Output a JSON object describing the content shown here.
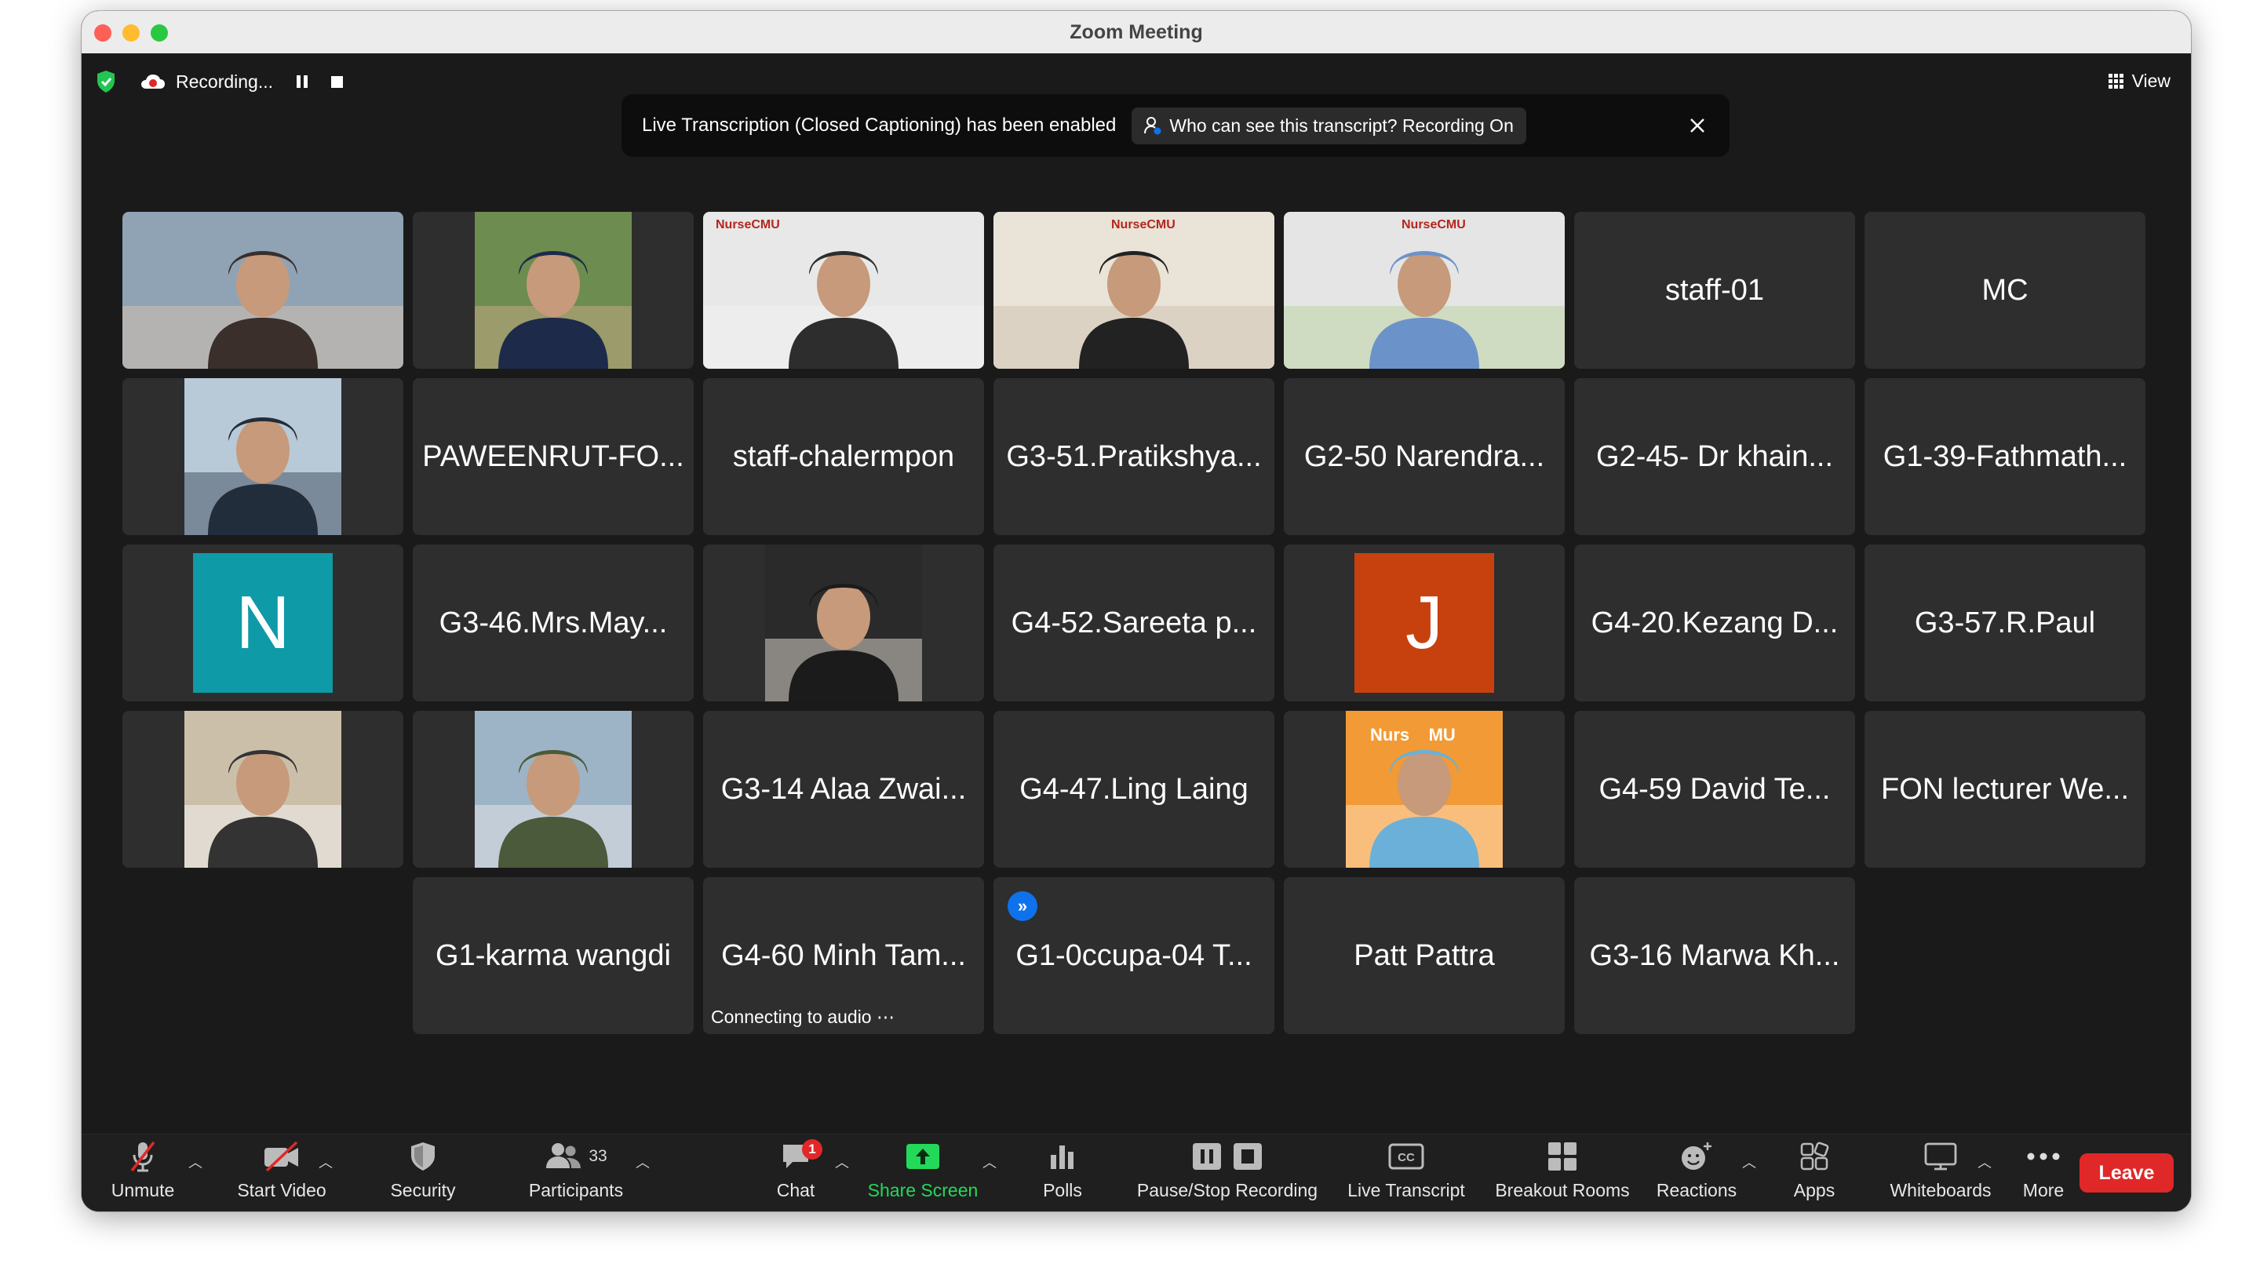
{
  "window": {
    "title": "Zoom Meeting"
  },
  "topbar": {
    "recording_label": "Recording...",
    "view_label": "View"
  },
  "banner": {
    "message": "Live Transcription (Closed Captioning) has been enabled",
    "who_label": "Who can see this transcript? Recording On"
  },
  "participants": [
    {
      "name": "",
      "kind": "video"
    },
    {
      "name": "",
      "kind": "video"
    },
    {
      "name": "",
      "kind": "video"
    },
    {
      "name": "",
      "kind": "video",
      "active": true
    },
    {
      "name": "",
      "kind": "video"
    },
    {
      "name": "staff-01",
      "kind": "name"
    },
    {
      "name": "MC",
      "kind": "name"
    },
    {
      "name": "",
      "kind": "video"
    },
    {
      "name": "PAWEENRUT-FO...",
      "kind": "name"
    },
    {
      "name": "staff-chalermpon",
      "kind": "name"
    },
    {
      "name": "G3-51.Pratikshya...",
      "kind": "name"
    },
    {
      "name": "G2-50 Narendra...",
      "kind": "name"
    },
    {
      "name": "G2-45- Dr khain...",
      "kind": "name"
    },
    {
      "name": "G1-39-Fathmath...",
      "kind": "name"
    },
    {
      "name": "",
      "kind": "avatar",
      "initial": "N",
      "color": "#0e9aa7"
    },
    {
      "name": "G3-46.Mrs.May...",
      "kind": "name"
    },
    {
      "name": "",
      "kind": "video"
    },
    {
      "name": "G4-52.Sareeta p...",
      "kind": "name"
    },
    {
      "name": "",
      "kind": "avatar",
      "initial": "J",
      "color": "#c7410f"
    },
    {
      "name": "G4-20.Kezang D...",
      "kind": "name"
    },
    {
      "name": "G3-57.R.Paul",
      "kind": "name"
    },
    {
      "name": "",
      "kind": "video"
    },
    {
      "name": "",
      "kind": "video"
    },
    {
      "name": "G3-14 Alaa Zwai...",
      "kind": "name"
    },
    {
      "name": "G4-47.Ling Laing",
      "kind": "name"
    },
    {
      "name": "",
      "kind": "video"
    },
    {
      "name": "G4-59 David  Te...",
      "kind": "name"
    },
    {
      "name": "FON lecturer We...",
      "kind": "name"
    },
    {
      "name": "G1-karma wangdi",
      "kind": "name"
    },
    {
      "name": "G4-60 Minh Tam...",
      "kind": "name",
      "status": "Connecting to audio  ⋯"
    },
    {
      "name": "G1-0ccupa-04 T...",
      "kind": "name",
      "badge": true
    },
    {
      "name": "Patt Pattra",
      "kind": "name"
    },
    {
      "name": "G3-16 Marwa Kh...",
      "kind": "name"
    }
  ],
  "video_logos": {
    "nursecmu": "NurseCMU",
    "nursecmu_partial": "Nurs    MU"
  },
  "toolbar": {
    "unmute": "Unmute",
    "start_video": "Start Video",
    "security": "Security",
    "participants": "Participants",
    "participants_count": "33",
    "chat": "Chat",
    "chat_badge": "1",
    "share_screen": "Share Screen",
    "polls": "Polls",
    "pause_stop_recording": "Pause/Stop Recording",
    "live_transcript": "Live Transcript",
    "live_transcript_cc": "CC",
    "breakout_rooms": "Breakout Rooms",
    "reactions": "Reactions",
    "apps": "Apps",
    "whiteboards": "Whiteboards",
    "more": "More",
    "leave": "Leave"
  },
  "colors": {
    "share_green": "#23d959",
    "leave_red": "#e02828",
    "active_speaker": "#23d959"
  }
}
